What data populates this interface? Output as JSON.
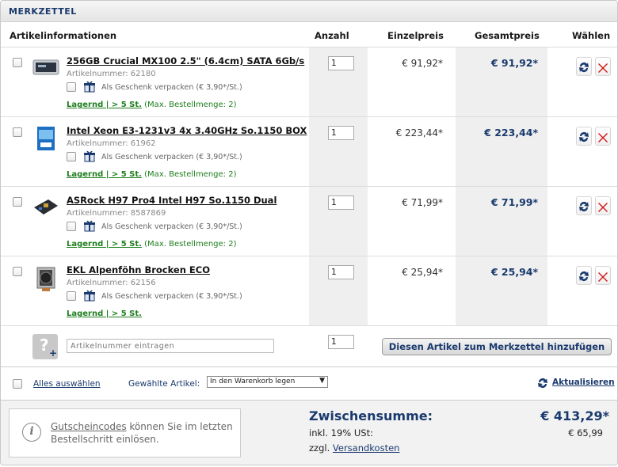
{
  "header": {
    "title": "MERKZETTEL"
  },
  "columns": {
    "info": "Artikelinformationen",
    "qty": "Anzahl",
    "unit_price": "Einzelpreis",
    "total_price": "Gesamtpreis",
    "select": "Wählen"
  },
  "items": [
    {
      "title": "256GB Crucial MX100 2.5\" (6.4cm) SATA 6Gb/s",
      "artnr": "Artikelnummer: 62180",
      "gift": "Als Geschenk verpacken (€ 3,90*/St.)",
      "stock": "Lagernd | > 5 St.",
      "max": "(Max. Bestellmenge: 2)",
      "qty": "1",
      "unit_price": "€ 91,92*",
      "total_price": "€ 91,92*",
      "thumb": "ssd-thumbnail"
    },
    {
      "title": "Intel Xeon E3-1231v3 4x 3.40GHz So.1150 BOX",
      "artnr": "Artikelnummer: 61962",
      "gift": "Als Geschenk verpacken (€ 3,90*/St.)",
      "stock": "Lagernd | > 5 St.",
      "max": "(Max. Bestellmenge: 2)",
      "qty": "1",
      "unit_price": "€ 223,44*",
      "total_price": "€ 223,44*",
      "thumb": "cpu-box-thumbnail"
    },
    {
      "title": "ASRock H97 Pro4 Intel H97 So.1150 Dual",
      "artnr": "Artikelnummer: 8587869",
      "gift": "Als Geschenk verpacken (€ 3,90*/St.)",
      "stock": "Lagernd | > 5 St.",
      "max": "(Max. Bestellmenge: 2)",
      "qty": "1",
      "unit_price": "€ 71,99*",
      "total_price": "€ 71,99*",
      "thumb": "mainboard-thumbnail"
    },
    {
      "title": "EKL Alpenföhn Brocken ECO",
      "artnr": "Artikelnummer: 62156",
      "gift": "Als Geschenk verpacken (€ 3,90*/St.)",
      "stock": "Lagernd | > 5 St.",
      "max": "",
      "qty": "1",
      "unit_price": "€ 25,94*",
      "total_price": "€ 25,94*",
      "thumb": "cooler-thumbnail"
    }
  ],
  "add_item": {
    "placeholder": "Artikelnummer eintragen",
    "qty": "1",
    "button": "Diesen Artikel zum Merkzettel hinzufügen"
  },
  "footer": {
    "select_all": "Alles auswählen",
    "selected_label": "Gewählte Artikel:",
    "action_select": "In den Warenkorb legen",
    "refresh": "Aktualisieren"
  },
  "summary": {
    "voucher_link": "Gutscheincodes",
    "voucher_text": " können Sie im letzten Bestellschritt einlösen.",
    "subtotal_label": "Zwischensumme:",
    "subtotal_value": "€ 413,29*",
    "vat_label": "inkl. 19% USt:",
    "vat_value": "€ 65,99",
    "shipping_prefix": "zzgl. ",
    "shipping_link": "Versandkosten"
  },
  "colors": {
    "brand_blue": "#1a3a6e",
    "stock_green": "#1e7e1e",
    "delete_red": "#d01a1a"
  }
}
